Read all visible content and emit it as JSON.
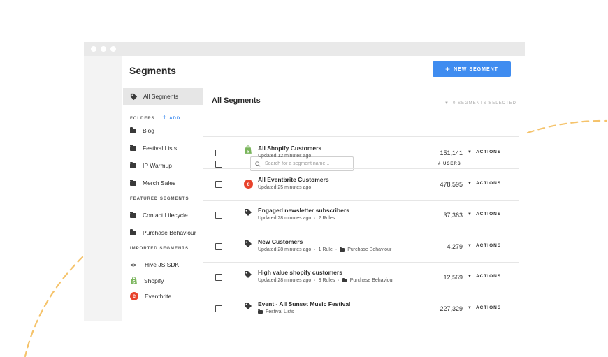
{
  "header": {
    "title": "Segments",
    "new_segment_label": "NEW SEGMENT"
  },
  "sidebar": {
    "all_segments_label": "All Segments",
    "folders_heading": "FOLDERS",
    "add_label": "ADD",
    "folders": [
      "Blog",
      "Festival Lists",
      "IP Warmup",
      "Merch Sales"
    ],
    "featured_heading": "FEATURED SEGMENTS",
    "featured": [
      "Contact Lifecycle",
      "Purchase Behaviour"
    ],
    "imported_heading": "IMPORTED SEGMENTS",
    "imported": [
      {
        "label": "Hive JS SDK",
        "icon": "code-icon"
      },
      {
        "label": "Shopify",
        "icon": "shopify-icon"
      },
      {
        "label": "Eventbrite",
        "icon": "eventbrite-icon"
      }
    ]
  },
  "main": {
    "title": "All Segments",
    "selected_count": "0 SEGMENTS SELECTED",
    "search_placeholder": "Search for a segment name...",
    "users_header": "# USERS",
    "actions_label": "ACTIONS",
    "rows": [
      {
        "icon": "shopify-icon",
        "name": "All Shopify Customers",
        "updated": "Updated 12 minutes ago",
        "rules": "",
        "folder": "",
        "users": "151,141"
      },
      {
        "icon": "eventbrite-icon",
        "name": "All Eventbrite Customers",
        "updated": "Updated 25 minutes ago",
        "rules": "",
        "folder": "",
        "users": "478,595"
      },
      {
        "icon": "tag-icon",
        "name": "Engaged newsletter subscribers",
        "updated": "Updated 28 minutes ago",
        "rules": "2 Rules",
        "folder": "",
        "users": "37,363"
      },
      {
        "icon": "tag-icon",
        "name": "New Customers",
        "updated": "Updated 28 minutes ago",
        "rules": "1 Rule",
        "folder": "Purchase Behaviour",
        "users": "4,279"
      },
      {
        "icon": "tag-icon",
        "name": "High value shopify customers",
        "updated": "Updated 28 minutes ago",
        "rules": "3 Rules",
        "folder": "Purchase Behaviour",
        "users": "12,569"
      },
      {
        "icon": "tag-icon",
        "name": "Event - All Sunset Music Festival",
        "updated": "",
        "rules": "",
        "folder": "Festival Lists",
        "users": "227,329"
      }
    ]
  },
  "colors": {
    "accent": "#3f8cf0",
    "shopify": "#7ab55c",
    "eventbrite": "#e8432c",
    "decoration": "#f5c36b"
  }
}
